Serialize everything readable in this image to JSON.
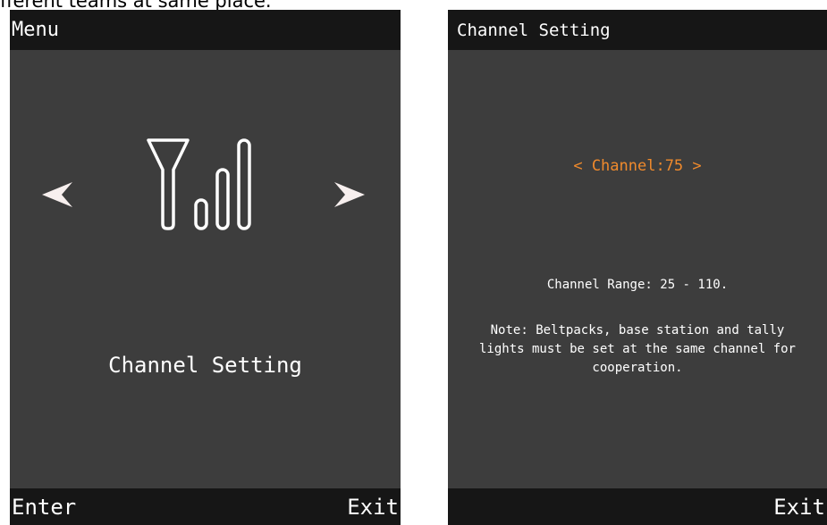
{
  "caption": "fferent teams at same place.",
  "menu_screen": {
    "title": "Menu",
    "icon": "antenna-signal-icon",
    "left_arrow": "chevron-left-icon",
    "right_arrow": "chevron-right-icon",
    "item_label": "Channel Setting",
    "softkey_left": "Enter",
    "softkey_right": "Exit"
  },
  "channel_screen": {
    "title": "Channel Setting",
    "channel_value": "< Channel:75 >",
    "range_text": "Channel Range: 25 - 110.",
    "note_text": "Note: Beltpacks, base station and tally lights must be set at the same channel for cooperation.",
    "softkey_right": "Exit"
  },
  "colors": {
    "screen_bg": "#3d3d3d",
    "bar_bg": "#161616",
    "accent": "#f08a2c",
    "text": "#ffffff"
  }
}
